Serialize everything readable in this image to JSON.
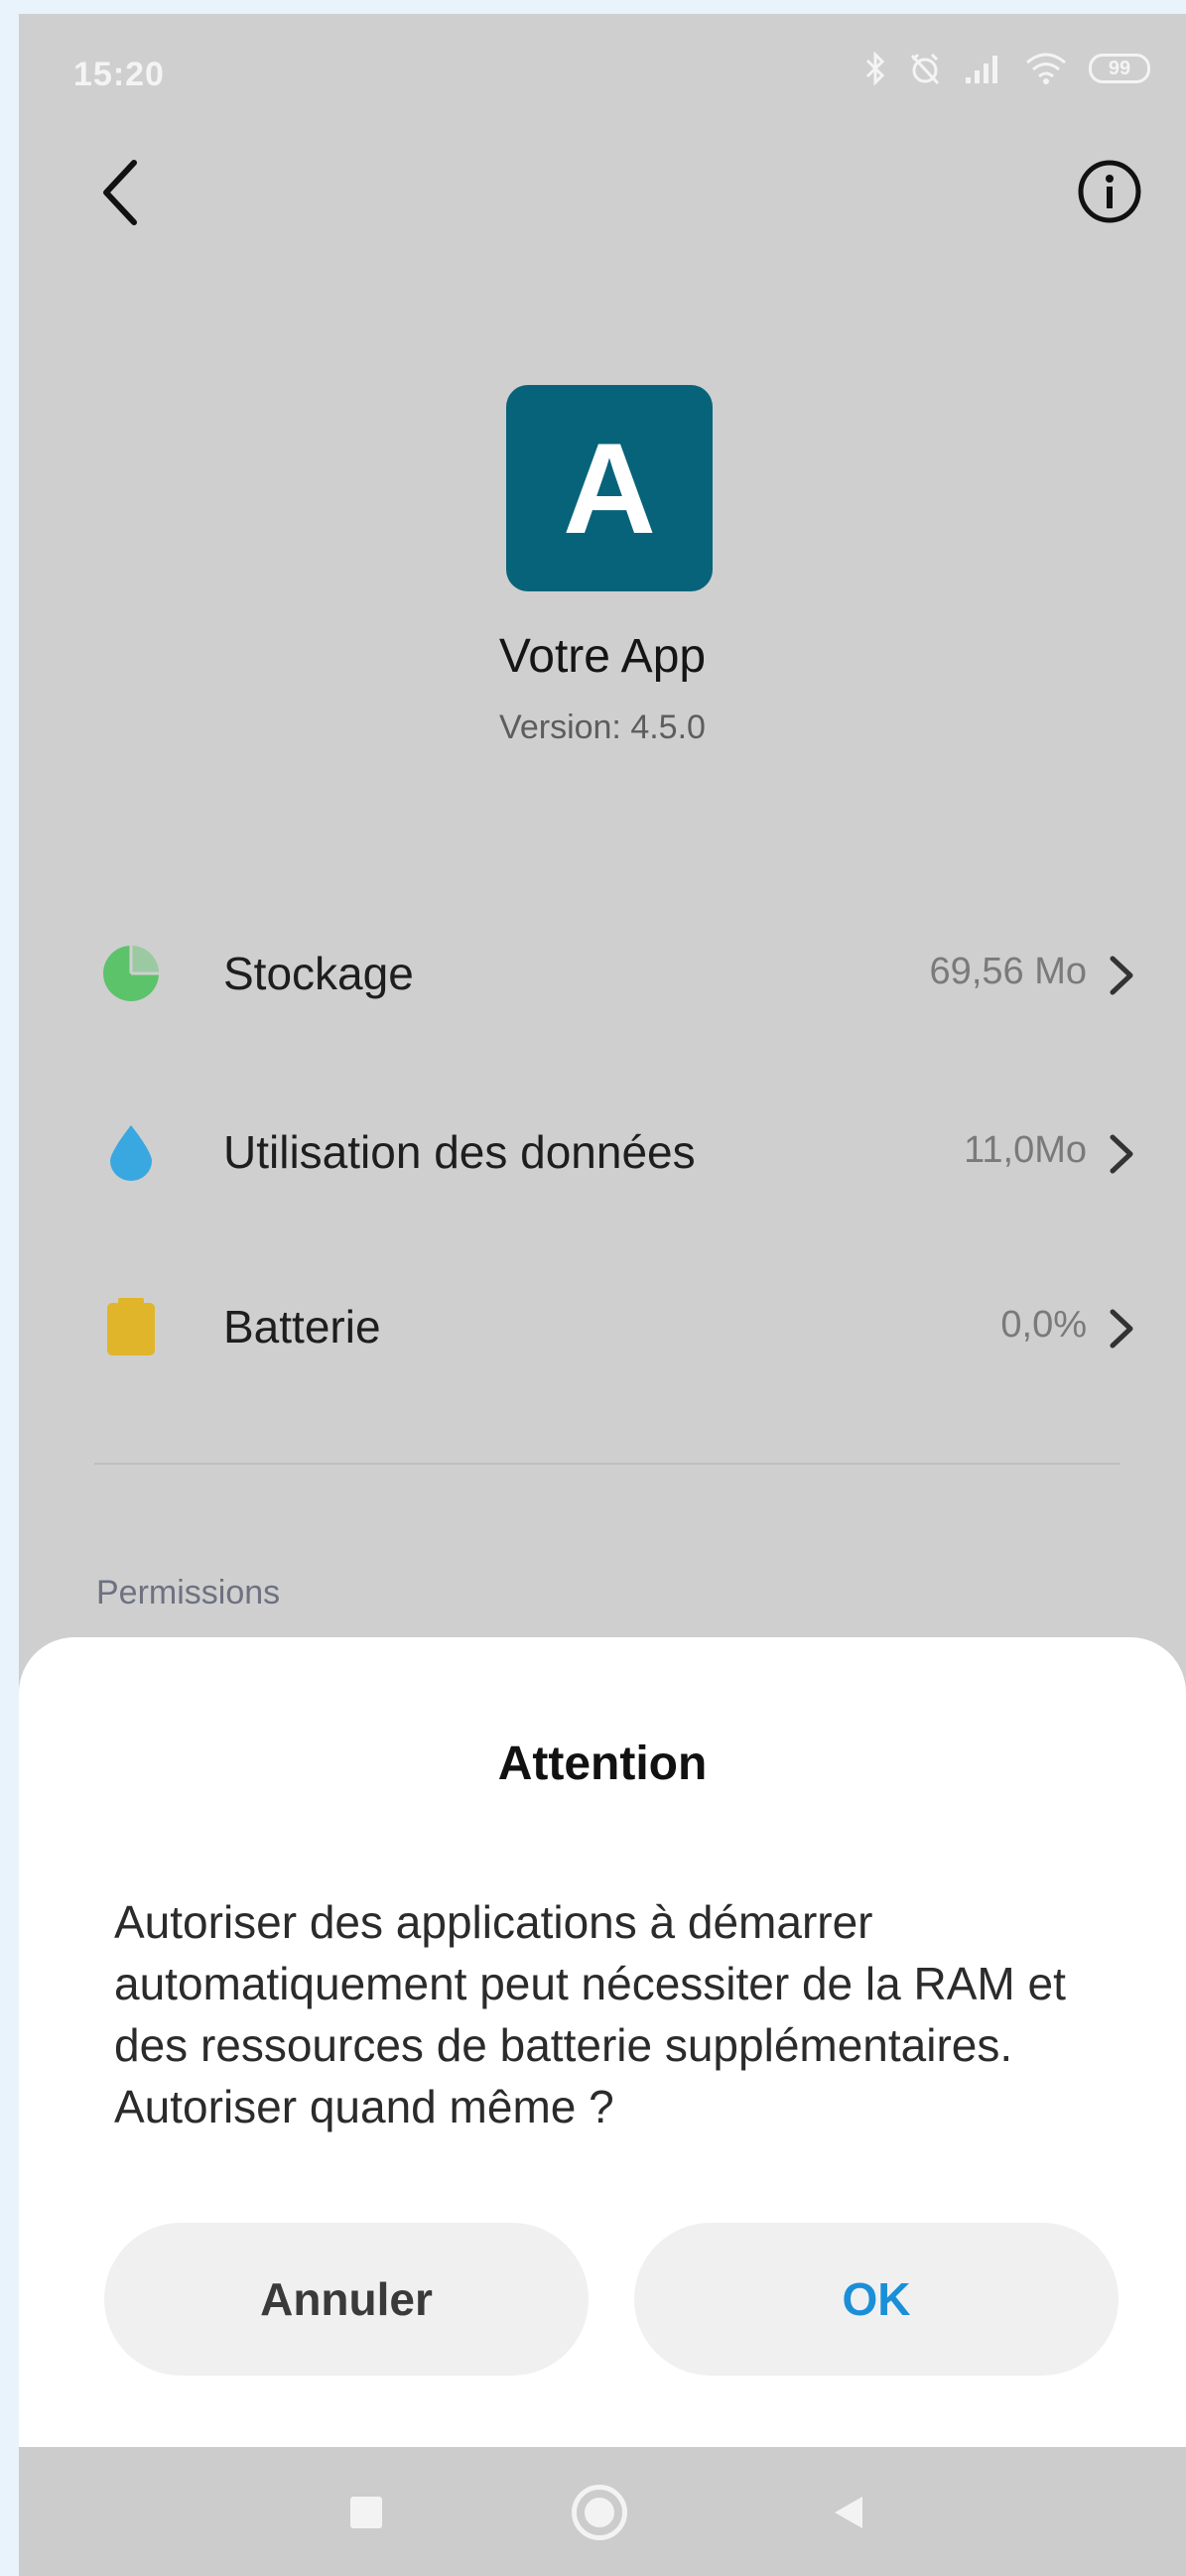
{
  "status_bar": {
    "time": "15:20",
    "battery_level": "99",
    "icons": [
      "bluetooth-icon",
      "alarm-off-icon",
      "signal-icon",
      "wifi-icon",
      "battery-icon"
    ]
  },
  "top_bar": {
    "back_icon": "chevron-left-icon",
    "info_icon": "info-circle-icon"
  },
  "app": {
    "icon_letter": "A",
    "icon_color": "#07637a",
    "name": "Votre App",
    "version": "Version: 4.5.0"
  },
  "rows": [
    {
      "label": "Stockage",
      "value": "69,56 Mo",
      "icon": "storage-pie-icon",
      "color": "#5cc36b"
    },
    {
      "label": "Utilisation des données",
      "value": "11,0Mo",
      "icon": "data-drop-icon",
      "color": "#3aa8e0"
    },
    {
      "label": "Batterie",
      "value": "0,0%",
      "icon": "battery-icon",
      "color": "#e0b52a"
    }
  ],
  "permissions_label": "Permissions",
  "dialog": {
    "title": "Attention",
    "message": "Autoriser des applications à démarrer automatiquement peut nécessiter de la RAM et des ressources de batterie supplémentaires. Autoriser quand même ?",
    "cancel_label": "Annuler",
    "ok_label": "OK",
    "ok_color": "#1a8fd8"
  },
  "nav_bar": {
    "icons": [
      "recents-square-icon",
      "home-circle-icon",
      "back-triangle-icon"
    ]
  }
}
